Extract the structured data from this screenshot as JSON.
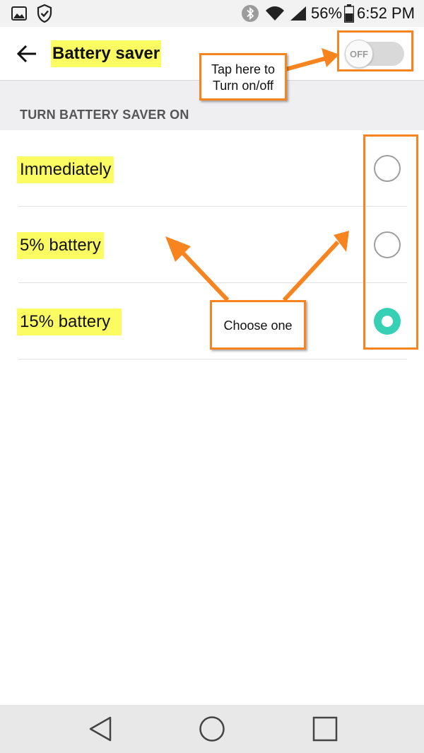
{
  "status_bar": {
    "battery_percent": "56%",
    "time": "6:52 PM",
    "icons": [
      "gallery-icon",
      "shield-icon",
      "bluetooth-icon",
      "wifi-icon",
      "signal-icon",
      "battery-icon"
    ]
  },
  "app_bar": {
    "title": "Battery saver",
    "toggle_label": "OFF",
    "toggle_on": false
  },
  "section": {
    "title": "TURN BATTERY SAVER ON"
  },
  "options": [
    {
      "label": "Immediately",
      "selected": false
    },
    {
      "label": "5% battery",
      "selected": false
    },
    {
      "label": "15% battery",
      "selected": true
    }
  ],
  "annotations": {
    "toggle_callout_line1": "Tap here to",
    "toggle_callout_line2": "Turn on/off",
    "options_callout": "Choose one",
    "accent_color": "#f7841e",
    "highlight_color": "#fbfb62"
  },
  "colors": {
    "radio_selected": "#36d1b5",
    "section_bg": "#efeff2"
  },
  "nav_bar": {
    "icons": [
      "back-triangle-icon",
      "home-circle-icon",
      "recents-square-icon"
    ]
  }
}
